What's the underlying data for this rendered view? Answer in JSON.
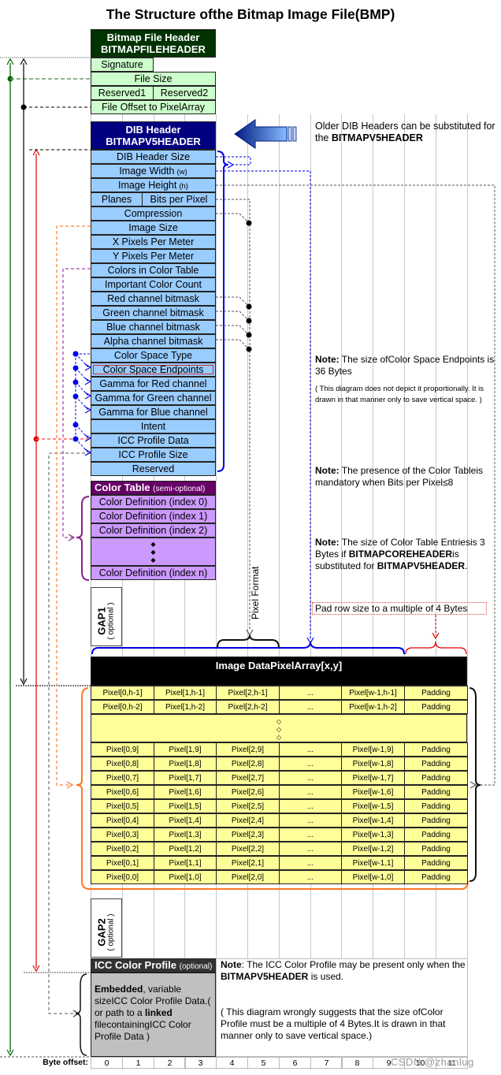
{
  "title": "The Structure ofthe Bitmap Image File(BMP)",
  "file_header": {
    "title_line1": "Bitmap File Header",
    "title_line2": "BITMAPFILEHEADER",
    "fields": [
      "Signature",
      "File Size",
      "Reserved1",
      "Reserved2",
      "File Offset to PixelArray"
    ]
  },
  "dib_header": {
    "title_line1": "DIB Header",
    "title_line2": "BITMAPV5HEADER",
    "fields": [
      "DIB Header Size",
      "Image Width",
      "Image Height",
      "Planes",
      "Bits per Pixel",
      "Compression",
      "Image Size",
      "X Pixels Per Meter",
      "Y Pixels Per Meter",
      "Colors in Color Table",
      "Important Color Count",
      "Red channel bitmask",
      "Green channel bitmask",
      "Blue channel bitmask",
      "Alpha channel bitmask",
      "Color Space Type",
      "Color Space Endpoints",
      "Gamma for Red channel",
      "Gamma for Green channel",
      "Gamma for Blue channel",
      "Intent",
      "ICC Profile Data",
      "ICC Profile Size",
      "Reserved"
    ],
    "width_suffix": "(w)",
    "height_suffix": "(h)",
    "highlighted_field": "Color Space Endpoints"
  },
  "older_headers_note": {
    "text": "Older DIB Headers can be substituted for",
    "text2_prefix": "the ",
    "text2_bold": "BITMAPV5HEADER"
  },
  "color_table": {
    "title": "Color Table",
    "subtitle": "(semi-optional)",
    "entries": [
      "Color Definition (index 0)",
      "Color Definition (index 1)",
      "Color Definition (index 2)",
      "Color Definition (index n)"
    ],
    "ellipsis": "◆\n◆\n◆"
  },
  "notes": {
    "color_space": {
      "bold": "Note:",
      "text": " The size ofColor Space Endpoints is 36 Bytes",
      "small": "( This diagram does not depict it proportionally. It is drawn in that manner only to save   vertical space. )"
    },
    "color_table_presence": {
      "bold": "Note:",
      "text": " The presence of the Color Tableis mandatory when Bits per Pixel≤8"
    },
    "color_table_size": {
      "bold": "Note:",
      "text": " The size of Color Table Entriesis 3 Bytes if ",
      "bold2": "BITMAPCOREHEADER",
      "text2": "is substituted for ",
      "bold3": "BITMAPV5HEADER",
      "text3": "."
    },
    "pad_row": "Pad row size to a multiple of 4 Bytes",
    "pixel_format": "Pixel Format",
    "icc": {
      "bold": "Note",
      "text": ": The ICC Color Profile may be present only when the ",
      "bold2": "BITMAPV5HEADER",
      "text2": " is used.",
      "text3": "( This diagram wrongly suggests that the size ofColor Profile must be a multiple of 4 Bytes.It is drawn in that manner only to save vertical space.)"
    }
  },
  "gaps": [
    {
      "label": "GAP1",
      "sub": "( optional )"
    },
    {
      "label": "GAP2",
      "sub": "( optional )"
    }
  ],
  "pixel_array": {
    "title": "Image DataPixelArray[x,y]",
    "rows": [
      [
        "Pixel[0,h-1]",
        "Pixel[1,h-1]",
        "Pixel[2,h-1]",
        "...",
        "Pixel[w-1,h-1]",
        "Padding"
      ],
      [
        "Pixel[0,h-2]",
        "Pixel[1,h-2]",
        "Pixel[2,h-2]",
        "...",
        "Pixel[w-1,h-2]",
        "Padding"
      ],
      [
        "Pixel[0,9]",
        "Pixel[1,9]",
        "Pixel[2,9]",
        "...",
        "Pixel[w-1,9]",
        "Padding"
      ],
      [
        "Pixel[0,8]",
        "Pixel[1,8]",
        "Pixel[2,8]",
        "...",
        "Pixel[w-1,8]",
        "Padding"
      ],
      [
        "Pixel[0,7]",
        "Pixel[1,7]",
        "Pixel[2,7]",
        "...",
        "Pixel[w-1,7]",
        "Padding"
      ],
      [
        "Pixel[0,6]",
        "Pixel[1,6]",
        "Pixel[2,6]",
        "...",
        "Pixel[w-1,6]",
        "Padding"
      ],
      [
        "Pixel[0,5]",
        "Pixel[1,5]",
        "Pixel[2,5]",
        "...",
        "Pixel[w-1,5]",
        "Padding"
      ],
      [
        "Pixel[0,4]",
        "Pixel[1,4]",
        "Pixel[2,4]",
        "...",
        "Pixel[w-1,4]",
        "Padding"
      ],
      [
        "Pixel[0,3]",
        "Pixel[1,3]",
        "Pixel[2,3]",
        "...",
        "Pixel[w-1,3]",
        "Padding"
      ],
      [
        "Pixel[0,2]",
        "Pixel[1,2]",
        "Pixel[2,2]",
        "...",
        "Pixel[w-1,2]",
        "Padding"
      ],
      [
        "Pixel[0,1]",
        "Pixel[1,1]",
        "Pixel[2,1]",
        "...",
        "Pixel[w-1,1]",
        "Padding"
      ],
      [
        "Pixel[0,0]",
        "Pixel[1,0]",
        "Pixel[2,0]",
        "...",
        "Pixel[w-1,0]",
        "Padding"
      ]
    ],
    "ellipsis": "◇\n◇\n◇"
  },
  "icc_profile": {
    "title": "ICC Color Profile",
    "subtitle": "(optional)",
    "body_bold": "Embedded",
    "body_text": ", variable sizeICC Color Profile Data.( or path to a ",
    "body_bold2": "linked",
    "body_text2": " filecontainingICC Color Profile Data )"
  },
  "byte_offset": {
    "label": "Byte offset:",
    "values": [
      "0",
      "1",
      "2",
      "3",
      "4",
      "5",
      "6",
      "7",
      "8",
      "9",
      "10",
      "11"
    ]
  },
  "watermark": "CSDN @zhanlug",
  "colors": {
    "file_header_bg": "#003300",
    "file_header_field": "#ccffcc",
    "dib_header_bg": "#000080",
    "dib_header_field": "#99ccff",
    "color_table_bg": "#660066",
    "color_table_field": "#cc99ff",
    "pixel_header_bg": "#000000",
    "pixel_field": "#ffff99",
    "icc_header_bg": "#333333",
    "icc_body": "#c0c0c0"
  }
}
